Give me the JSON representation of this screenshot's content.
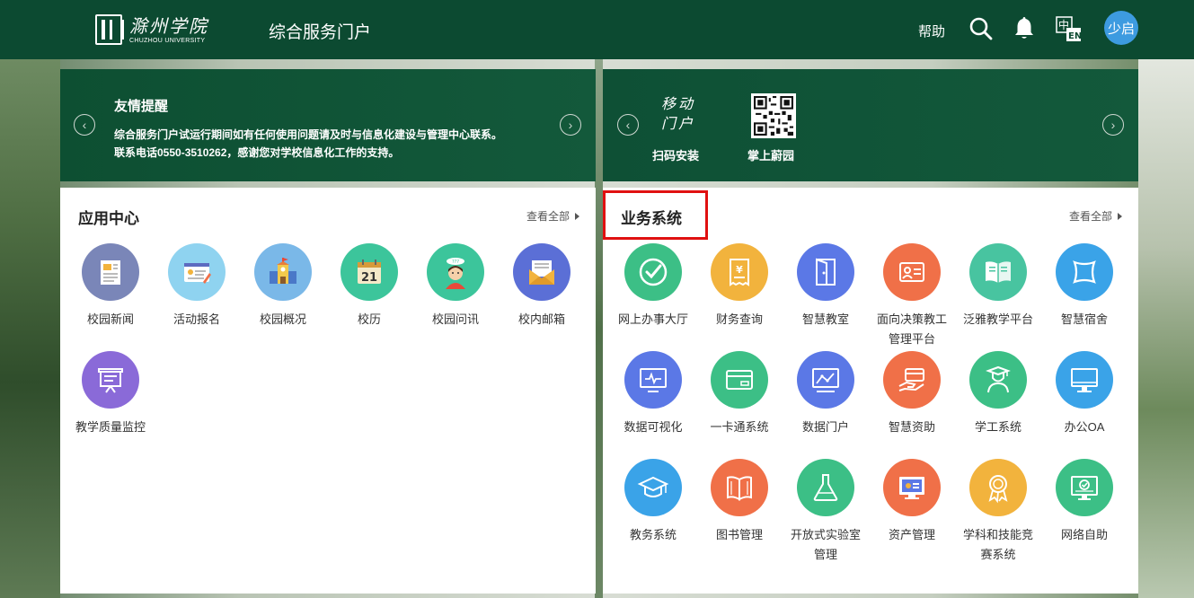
{
  "header": {
    "logo_cn": "滁州学院",
    "logo_en": "CHUZHOU UNIVERSITY",
    "portal_title": "综合服务门户",
    "help": "帮助",
    "avatar_text": "少启",
    "lang_icon": "中/EN"
  },
  "notice": {
    "title": "友情提醒",
    "line1": "综合服务门户试运行期间如有任何使用问题请及时与信息化建设与管理中心联系。",
    "line2": "联系电话0550-3510262，感谢您对学校信息化工作的支持。"
  },
  "mobile": {
    "portal_text": "移动门户",
    "scan_label": "扫码安装",
    "app_label": "掌上蔚园"
  },
  "app_center": {
    "title": "应用中心",
    "view_all": "查看全部",
    "apps": [
      {
        "label": "校园新闻",
        "icon": "newspaper-icon",
        "color": "#7a86b8"
      },
      {
        "label": "活动报名",
        "icon": "registration-form-icon",
        "color": "#8fd3f0"
      },
      {
        "label": "校园概况",
        "icon": "school-building-icon",
        "color": "#7ab8e8"
      },
      {
        "label": "校历",
        "icon": "calendar-icon",
        "color": "#3cc59b"
      },
      {
        "label": "校园问讯",
        "icon": "student-avatar-icon",
        "color": "#3cc59b"
      },
      {
        "label": "校内邮箱",
        "icon": "mail-icon",
        "color": "#5b6fd6"
      },
      {
        "label": "教学质量监控",
        "icon": "presentation-board-icon",
        "color": "#8a6ad8"
      }
    ]
  },
  "business": {
    "title": "业务系统",
    "view_all": "查看全部",
    "apps": [
      {
        "label": "网上办事大厅",
        "icon": "check-circle-icon",
        "color": "#3cbf86"
      },
      {
        "label": "财务查询",
        "icon": "receipt-yen-icon",
        "color": "#f2b33d"
      },
      {
        "label": "智慧教室",
        "icon": "door-icon",
        "color": "#5b78e6"
      },
      {
        "label": "面向决策教工管理平台",
        "icon": "id-card-icon",
        "color": "#f07048"
      },
      {
        "label": "泛雅教学平台",
        "icon": "open-book-icon",
        "color": "#48c4a0"
      },
      {
        "label": "智慧宿舍",
        "icon": "pillow-icon",
        "color": "#3aa3e8"
      },
      {
        "label": "数据可视化",
        "icon": "monitor-pulse-icon",
        "color": "#5b78e6"
      },
      {
        "label": "一卡通系统",
        "icon": "card-icon",
        "color": "#3cbf86"
      },
      {
        "label": "数据门户",
        "icon": "monitor-chart-icon",
        "color": "#5b78e6"
      },
      {
        "label": "智慧资助",
        "icon": "hand-card-icon",
        "color": "#f07048"
      },
      {
        "label": "学工系统",
        "icon": "graduate-icon",
        "color": "#3cbf86"
      },
      {
        "label": "办公OA",
        "icon": "desktop-icon",
        "color": "#3aa3e8"
      },
      {
        "label": "教务系统",
        "icon": "mortarboard-icon",
        "color": "#3aa3e8"
      },
      {
        "label": "图书管理",
        "icon": "book-icon",
        "color": "#f07048"
      },
      {
        "label": "开放式实验室管理",
        "icon": "flask-icon",
        "color": "#3cbf86"
      },
      {
        "label": "资产管理",
        "icon": "monitor-asset-icon",
        "color": "#f07048"
      },
      {
        "label": "学科和技能竞赛系统",
        "icon": "award-medal-icon",
        "color": "#f2b33d"
      },
      {
        "label": "网络自助",
        "icon": "monitor-check-icon",
        "color": "#3cbf86"
      }
    ]
  }
}
